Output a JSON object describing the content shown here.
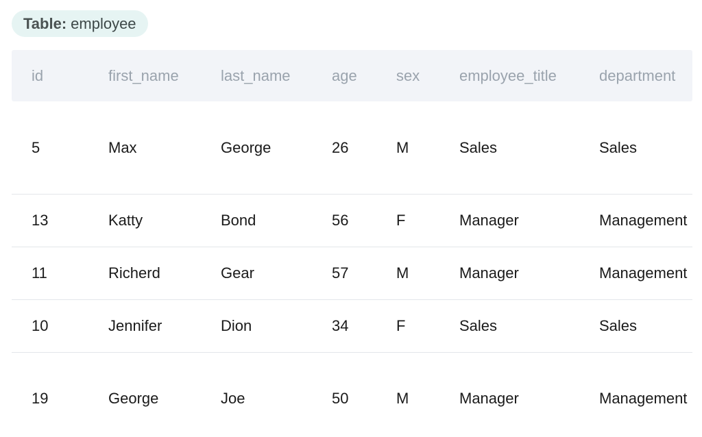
{
  "table_chip": {
    "key_label": "Table:",
    "table_name": "employee"
  },
  "columns": [
    "id",
    "first_name",
    "last_name",
    "age",
    "sex",
    "employee_title",
    "department"
  ],
  "rows": [
    [
      "5",
      "Max",
      "George",
      "26",
      "M",
      "Sales",
      "Sales"
    ],
    [
      "13",
      "Katty",
      "Bond",
      "56",
      "F",
      "Manager",
      "Management"
    ],
    [
      "11",
      "Richerd",
      "Gear",
      "57",
      "M",
      "Manager",
      "Management"
    ],
    [
      "10",
      "Jennifer",
      "Dion",
      "34",
      "F",
      "Sales",
      "Sales"
    ],
    [
      "19",
      "George",
      "Joe",
      "50",
      "M",
      "Manager",
      "Management"
    ]
  ],
  "colors": {
    "chip_bg": "#e6f4f3",
    "header_bg": "#f2f4f8",
    "header_text": "#9aa3ad",
    "row_divider": "#e3e6ea"
  }
}
